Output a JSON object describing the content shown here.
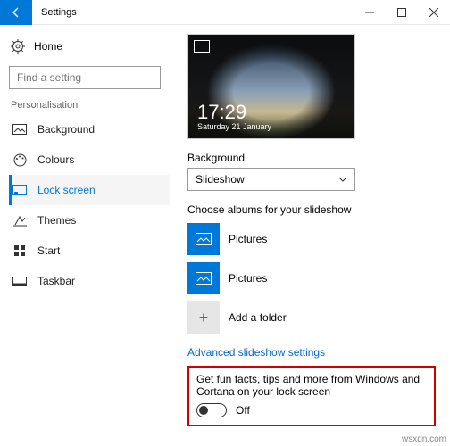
{
  "titlebar": {
    "title": "Settings"
  },
  "left": {
    "home": "Home",
    "search_placeholder": "Find a setting",
    "section": "Personalisation",
    "items": [
      {
        "label": "Background"
      },
      {
        "label": "Colours"
      },
      {
        "label": "Lock screen"
      },
      {
        "label": "Themes"
      },
      {
        "label": "Start"
      },
      {
        "label": "Taskbar"
      }
    ]
  },
  "preview": {
    "time": "17:29",
    "date": "Saturday 21 January"
  },
  "background": {
    "label": "Background",
    "value": "Slideshow"
  },
  "albums": {
    "label": "Choose albums for your slideshow",
    "items": [
      {
        "label": "Pictures"
      },
      {
        "label": "Pictures"
      }
    ],
    "add": "Add a folder"
  },
  "advanced_link": "Advanced slideshow settings",
  "funfacts": {
    "text": "Get fun facts, tips and more from Windows and Cortana on your lock screen",
    "state": "Off"
  },
  "watermark": "wsxdn.com"
}
